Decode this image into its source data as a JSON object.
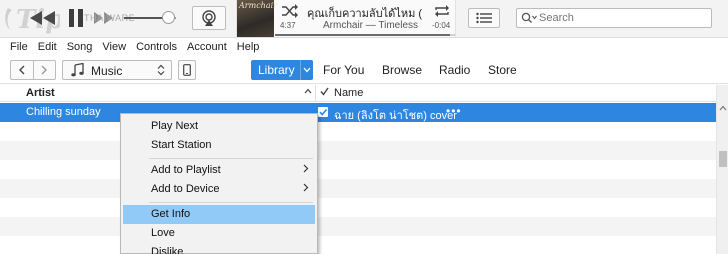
{
  "player": {
    "watermark": "THAIWARE",
    "volume_level": 0.85,
    "progress_fraction": 0.97,
    "now_playing": {
      "album_art_text": "Armchair",
      "title": "คุณเก็บความลับได้ไหม (",
      "subtitle": "Armchair — Timeless",
      "elapsed": "4:37",
      "remaining": "-0:04"
    },
    "search_placeholder": "Search"
  },
  "menubar": {
    "items": [
      "File",
      "Edit",
      "Song",
      "View",
      "Controls",
      "Account",
      "Help"
    ]
  },
  "navbar": {
    "media_kind": "Music",
    "tabs": {
      "library": "Library",
      "for_you": "For You",
      "browse": "Browse",
      "radio": "Radio",
      "store": "Store"
    }
  },
  "table": {
    "columns": {
      "artist": "Artist",
      "name": "Name"
    },
    "rows": [
      {
        "artist": "Chilling sunday",
        "name": "ฉาย (ลิงโต น่าโชต) cover",
        "more": "•••",
        "selected": true
      }
    ]
  },
  "context_menu": {
    "items": [
      {
        "label": "Play Next"
      },
      {
        "label": "Start Station"
      },
      {
        "label": "Add to Playlist",
        "submenu": true
      },
      {
        "label": "Add to Device",
        "submenu": true
      },
      {
        "label": "Get Info",
        "highlighted": true
      },
      {
        "label": "Love"
      },
      {
        "label": "Dislike"
      }
    ]
  },
  "colors": {
    "accent": "#2d86e0",
    "menu_highlight": "#91c9f7"
  }
}
